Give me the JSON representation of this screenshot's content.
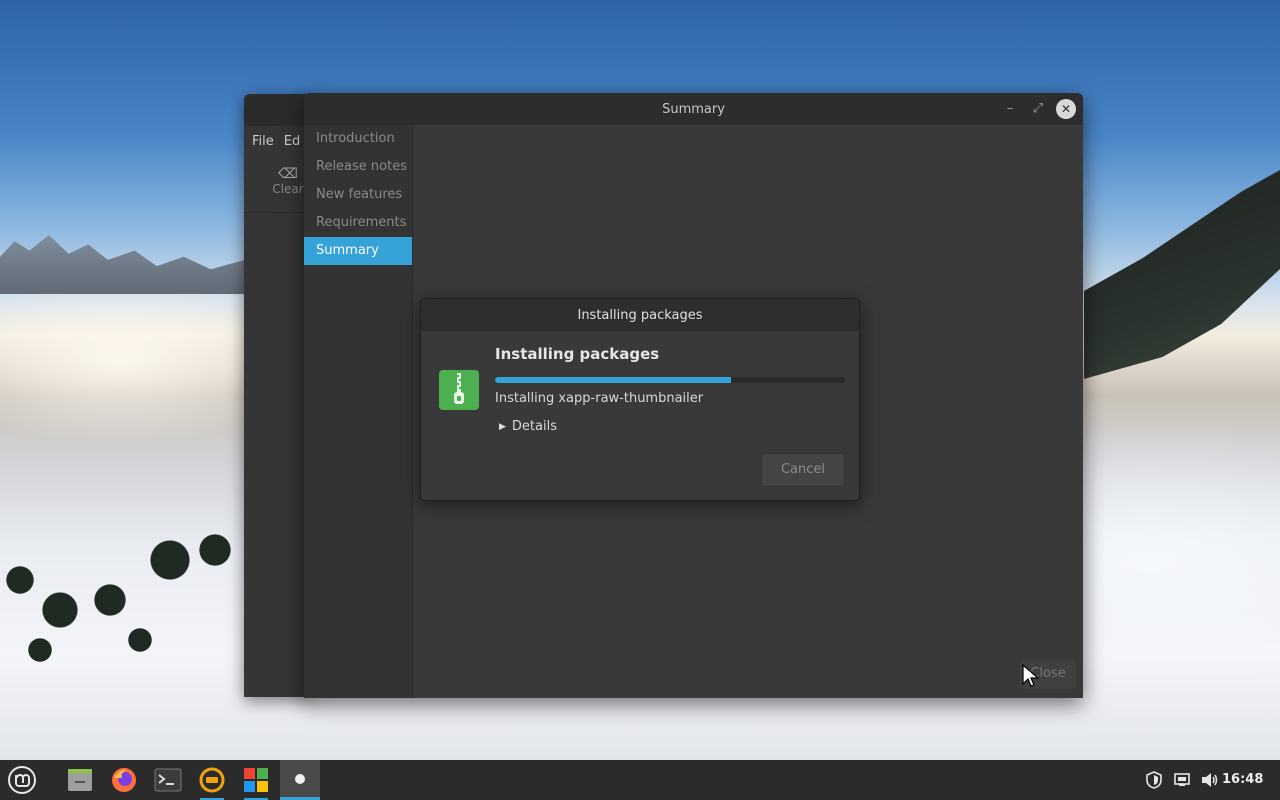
{
  "background_window": {
    "menu": [
      "File",
      "Ed"
    ],
    "toolbar_clear_label": "Clear"
  },
  "main_window": {
    "title": "Summary",
    "sidebar": {
      "items": [
        {
          "label": "Introduction",
          "active": false
        },
        {
          "label": "Release notes",
          "active": false
        },
        {
          "label": "New features",
          "active": false
        },
        {
          "label": "Requirements",
          "active": false
        },
        {
          "label": "Summary",
          "active": true
        }
      ]
    },
    "close_button_label": "Close"
  },
  "dialog": {
    "title": "Installing packages",
    "heading": "Installing packages",
    "progress_fraction": 0.675,
    "status": "Installing xapp-raw-thumbnailer",
    "details_label": "Details",
    "cancel_label": "Cancel",
    "icon": "package-archive-icon"
  },
  "taskbar": {
    "items": [
      "mint-menu-icon",
      "file-manager-icon",
      "firefox-icon",
      "terminal-icon",
      "update-manager-icon",
      "software-manager-icon",
      "welcome-app-icon"
    ],
    "tray": [
      "shield-icon",
      "network-icon",
      "volume-icon"
    ],
    "clock": "16:48"
  },
  "colors": {
    "accent": "#35a2d8",
    "window_bg": "#383838",
    "titlebar_bg": "#2d2d2d",
    "taskbar_bg": "#2b2b2b",
    "package_icon_green": "#4caf50"
  }
}
